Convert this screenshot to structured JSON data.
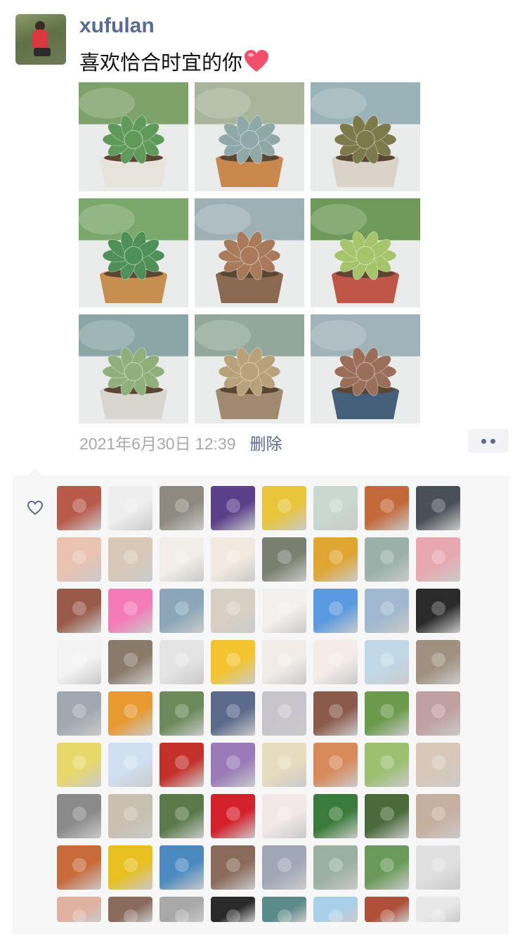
{
  "post": {
    "username": "xufulan",
    "text": "喜欢恰合时宜的你",
    "emoji": "heart",
    "timestamp": "2021年6月30日 12:39",
    "delete_label": "删除",
    "photos": [
      {
        "label": "succulent-green-rosette",
        "rosette": "#5f9a5a",
        "pot": "#e8e4dc",
        "bg": "#7da26a"
      },
      {
        "label": "succulent-blue-echeveria",
        "rosette": "#8fa8a8",
        "pot": "#c8884e",
        "bg": "#a8b59a"
      },
      {
        "label": "succulent-trailing-pot",
        "rosette": "#7c7a4a",
        "pot": "#d9d3c8",
        "bg": "#9ab3b8"
      },
      {
        "label": "succulent-small-bowl",
        "rosette": "#4f8f58",
        "pot": "#c78f4f",
        "bg": "#7aa86a"
      },
      {
        "label": "succulent-three-stems",
        "rosette": "#a87a5a",
        "pot": "#8a6a50",
        "bg": "#9db0b4"
      },
      {
        "label": "succulent-yellow-green",
        "rosette": "#a6c56a",
        "pot": "#c05648",
        "bg": "#6f9a5a"
      },
      {
        "label": "succulent-pale-leaves",
        "rosette": "#8fb07a",
        "pot": "#d9d6cf",
        "bg": "#8aa6a6"
      },
      {
        "label": "succulent-cluster",
        "rosette": "#b7a27a",
        "pot": "#a08a70",
        "bg": "#93a89a"
      },
      {
        "label": "succulent-blue-vase",
        "rosette": "#9a6e58",
        "pot": "#44607a",
        "bg": "#9fb3b8"
      }
    ]
  },
  "likes": {
    "heart_color": "#576b95",
    "rows_full": 8,
    "liker_colors": [
      "#b85a4a",
      "#eeeeee",
      "#8f8a80",
      "#5a3f8a",
      "#e8c53a",
      "#c9d8d0",
      "#c46a3a",
      "#4a5058",
      "#e9c2b2",
      "#d9c8b8",
      "#f2eee8",
      "#f2eae0",
      "#7a8070",
      "#e0a632",
      "#9ab0a8",
      "#e8a8b0",
      "#9a5a4a",
      "#f47ab8",
      "#8aa6b8",
      "#d9d0c4",
      "#f3f0ee",
      "#5a9ae0",
      "#a0b8d0",
      "#2a2a2a",
      "#f3f3f3",
      "#8a7a6a",
      "#e4e4e4",
      "#f4c430",
      "#f1ece8",
      "#f4ece8",
      "#c0d8e8",
      "#a09080",
      "#a0a8b0",
      "#e89a30",
      "#6a8a5a",
      "#5a6a8a",
      "#c8c4cc",
      "#8a5a4a",
      "#6a9a4a",
      "#c0a0a0",
      "#e8d86a",
      "#d0e0f0",
      "#c4302a",
      "#9a7ab8",
      "#e8dcc0",
      "#d88a5a",
      "#9ac070",
      "#d8c8b8",
      "#8a8a8a",
      "#c8c0b0",
      "#5a7a4a",
      "#d4202a",
      "#f2e8e8",
      "#3a7a3a",
      "#4a6a3a",
      "#c8b0a0",
      "#c86a3a",
      "#e8c020",
      "#4a8ac0",
      "#8a6a5a",
      "#a0a8b8",
      "#9ab0a0",
      "#6a9a5a",
      "#e0e0e0",
      "#e0b0a0",
      "#8a6a5a",
      "#a8a8a8",
      "#2a2a2a",
      "#5a8a8a",
      "#a8d0e8",
      "#b0503a",
      "#e8e8e8"
    ]
  }
}
